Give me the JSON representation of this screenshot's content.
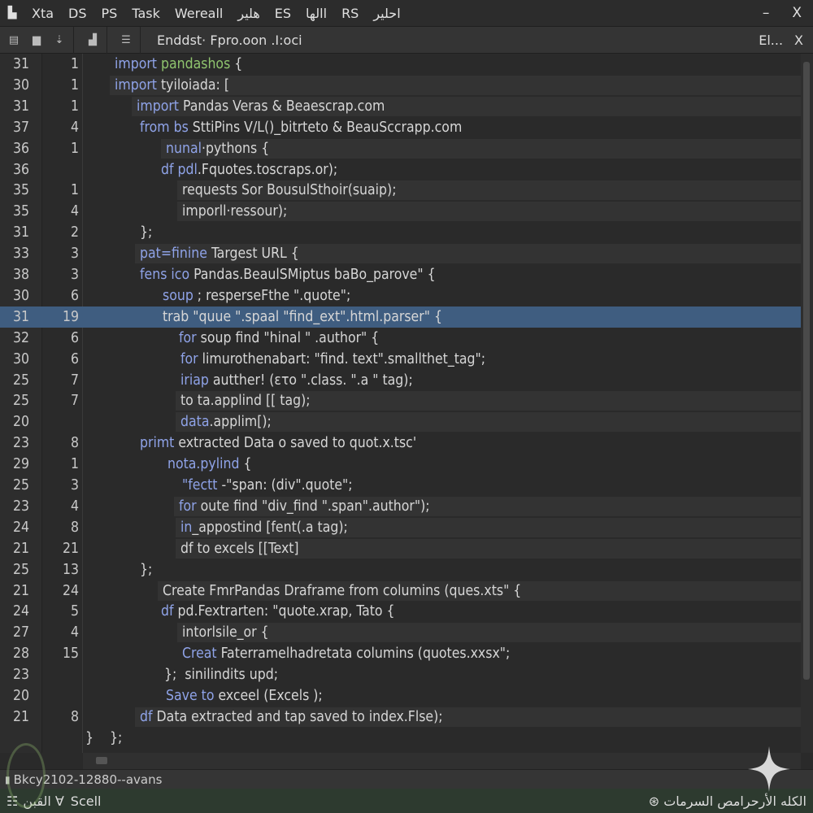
{
  "titlebar": {
    "menu": [
      "Xta",
      "DS",
      "PS",
      "Task",
      "Wereall",
      "هلير",
      "ES",
      "الهاl",
      "RS",
      "احلير"
    ],
    "minimize": "–",
    "close": "X"
  },
  "toolbar": {
    "file_title": "Enddst· Fpro.oon .I:oci",
    "right_label": "El...",
    "close": "X"
  },
  "lines": [
    {
      "n1": "31",
      "n2": "1",
      "kw": "import",
      "acc": " pandashos",
      "text": " {"
    },
    {
      "n1": "30",
      "n2": "1",
      "kw": "import",
      "text": " tyiloiada: ["
    },
    {
      "n1": "31",
      "n2": "1",
      "kw": "import",
      "text": " Pandas Veras & Beaescrap.com"
    },
    {
      "n1": "37",
      "n2": "4",
      "kw": "from bs",
      "text": " SttiPins V/L()_bitrteto & BeauSccrapp.com"
    },
    {
      "n1": "36",
      "n2": "1",
      "kw": "nunal",
      "text": "·pythons {"
    },
    {
      "n1": "36",
      "n2": "",
      "kw": "df pdl",
      "text": ".Fquotes.toscraps.or);"
    },
    {
      "n1": "35",
      "n2": "1",
      "kw": "",
      "text": "requests Sor BousulSthoir(suaip);"
    },
    {
      "n1": "35",
      "n2": "4",
      "kw": "",
      "text": "imporll·ressour);"
    },
    {
      "n1": "31",
      "n2": "2",
      "kw": "",
      "text": "};"
    },
    {
      "n1": "33",
      "n2": "3",
      "kw": "pat=finine",
      "text": " Targest URL {"
    },
    {
      "n1": "38",
      "n2": "3",
      "kw": "fens ico",
      "text": " Pandas.BeaulSMiptus baBo_parove\" {"
    },
    {
      "n1": "30",
      "n2": "6",
      "kw": "soup",
      "text": " ; resperseFthe \".quote\";"
    },
    {
      "n1": "31",
      "n2": "19",
      "kw": "",
      "text": "trab \"quue \".spaal \"find_ext\".html.parser\" {"
    },
    {
      "n1": "32",
      "n2": "6",
      "kw": "for",
      "text": " soup find \"hinal \" .author\" {"
    },
    {
      "n1": "30",
      "n2": "6",
      "kw": "for",
      "text": " limurothenabart: \"find. text\".smallthet_tag\";"
    },
    {
      "n1": "25",
      "n2": "7",
      "kw": "iriap",
      "text": " autther! (ετο \".class. \".a \" tag);"
    },
    {
      "n1": "25",
      "n2": "7",
      "kw": "",
      "text": "to ta.applind [[ tag);"
    },
    {
      "n1": "20",
      "n2": "",
      "kw": "data",
      "text": ".applim[);"
    },
    {
      "n1": "23",
      "n2": "8",
      "kw": "primt",
      "text": " extracted Data o saved to quot.x.tsc'"
    },
    {
      "n1": "29",
      "n2": "1",
      "kw": "nota.pylind",
      "text": " {"
    },
    {
      "n1": "25",
      "n2": "3",
      "kw": "\"fectt",
      "text": " -\"span: (div\".quote\";"
    },
    {
      "n1": "23",
      "n2": "4",
      "kw": "for",
      "text": " oute find \"div_find \".span\".author\");"
    },
    {
      "n1": "24",
      "n2": "8",
      "kw": "in",
      "text": "_appostind [fent(.a tag);"
    },
    {
      "n1": "21",
      "n2": "21",
      "kw": "",
      "text": "df to excels [[Text]"
    },
    {
      "n1": "25",
      "n2": "13",
      "kw": "",
      "text": "};"
    },
    {
      "n1": "21",
      "n2": "24",
      "kw": "",
      "text": "Create FmrPandas Draframe from columins (ques.xts\" {"
    },
    {
      "n1": "24",
      "n2": "5",
      "kw": "df",
      "text": " pd.Fextrarten: \"quote.xrap, Tato {"
    },
    {
      "n1": "27",
      "n2": "4",
      "kw": "",
      "text": "intorlsile_or {"
    },
    {
      "n1": "28",
      "n2": "15",
      "kw": "Creat",
      "text": " Faterramelhadretata columins (quotes.xxsx\";"
    },
    {
      "n1": "23",
      "n2": "",
      "kw": "",
      "text": "};  sinilindits upd;"
    },
    {
      "n1": "20",
      "n2": "",
      "kw": "Save to",
      "text": " exceel (Excels );"
    },
    {
      "n1": "21",
      "n2": "8",
      "kw": "df",
      "text": " Data extracted and tap saved to index.Flse);"
    },
    {
      "n1": "",
      "n2": "",
      "kw": "",
      "text": "}    };"
    }
  ],
  "statusbar": {
    "text": "Bkcy2102-12880--avans"
  },
  "bottombar": {
    "left_label": "Scell",
    "left_arabic": "القبن ∀",
    "right_text": "الكله الأرحرامص السرمات"
  }
}
